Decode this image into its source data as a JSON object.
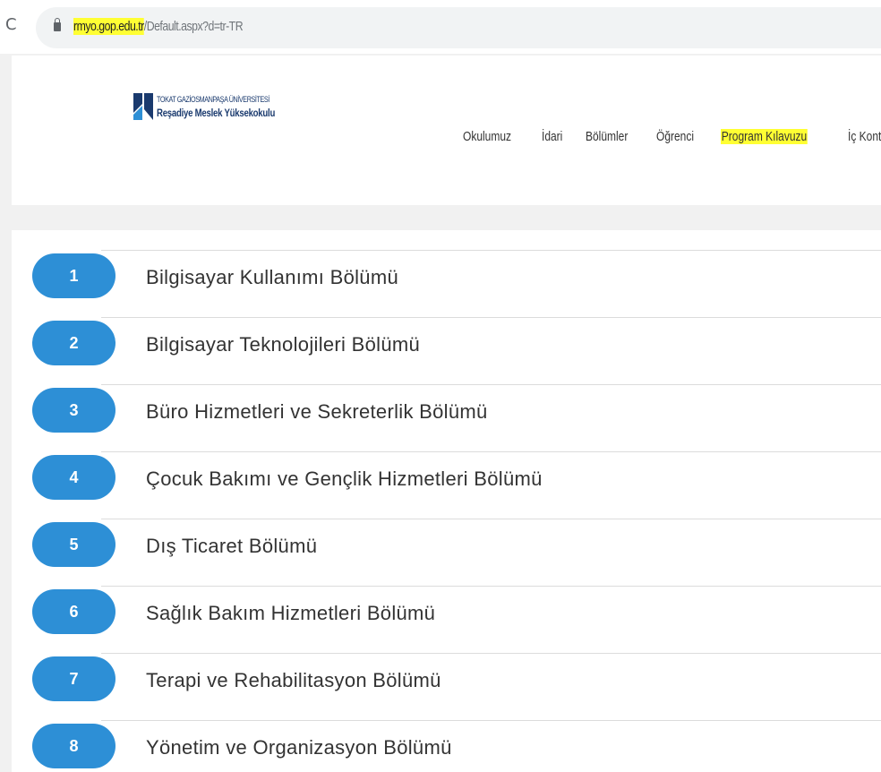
{
  "browser": {
    "reload_icon": "reload-icon",
    "lock_icon": "lock-icon",
    "url_host": "rmyo.gop.edu.tr",
    "url_path": "/Default.aspx?d=tr-TR",
    "highlight_color": "#ffff33"
  },
  "header": {
    "logo_top": "TOKAT GAZİOSMANPAŞA ÜNİVERSİTESİ",
    "logo_main": "Reşadiye Meslek Yüksekokulu",
    "nav": [
      "Okulumuz",
      "İdari",
      "Bölümler",
      "Öğrenci",
      "Program Kılavuzu",
      "İç Kontrol"
    ]
  },
  "departments": {
    "accent_color": "#2d8fd6",
    "items": [
      {
        "num": "1",
        "label": "Bilgisayar Kullanımı Bölümü"
      },
      {
        "num": "2",
        "label": "Bilgisayar Teknolojileri Bölümü"
      },
      {
        "num": "3",
        "label": "Büro Hizmetleri ve Sekreterlik Bölümü"
      },
      {
        "num": "4",
        "label": "Çocuk Bakımı ve Gençlik Hizmetleri Bölümü"
      },
      {
        "num": "5",
        "label": "Dış Ticaret Bölümü"
      },
      {
        "num": "6",
        "label": "Sağlık Bakım Hizmetleri Bölümü"
      },
      {
        "num": "7",
        "label": "Terapi ve Rehabilitasyon Bölümü"
      },
      {
        "num": "8",
        "label": "Yönetim ve Organizasyon Bölümü"
      }
    ]
  }
}
